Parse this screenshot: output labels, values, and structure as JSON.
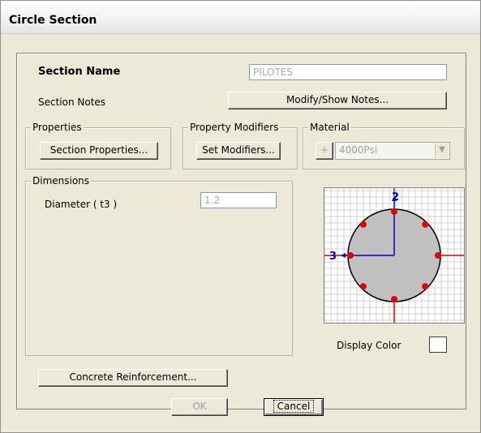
{
  "window": {
    "title": "Circle Section"
  },
  "section_name": {
    "label": "Section Name",
    "value": "PILOTES"
  },
  "section_notes": {
    "label": "Section Notes",
    "button": "Modify/Show Notes..."
  },
  "properties": {
    "legend": "Properties",
    "button": "Section Properties..."
  },
  "modifiers": {
    "legend": "Property Modifiers",
    "button": "Set Modifiers..."
  },
  "material": {
    "legend": "Material",
    "plus_label": "+",
    "selected": "4000Psi"
  },
  "dimensions": {
    "legend": "Dimensions",
    "diameter_label": "Diameter  ( t3 )",
    "diameter_value": "1.2"
  },
  "preview": {
    "axis_2": "2",
    "axis_3": "3",
    "rebar_count": 8,
    "colors": {
      "section": "#c0c0c0",
      "rebar": "#e00000",
      "axis": "#0000cc",
      "grid": "#d0d0d0"
    }
  },
  "display_color": {
    "label": "Display Color"
  },
  "buttons": {
    "reinforcement": "Concrete Reinforcement...",
    "ok": "OK",
    "cancel": "Cancel"
  }
}
